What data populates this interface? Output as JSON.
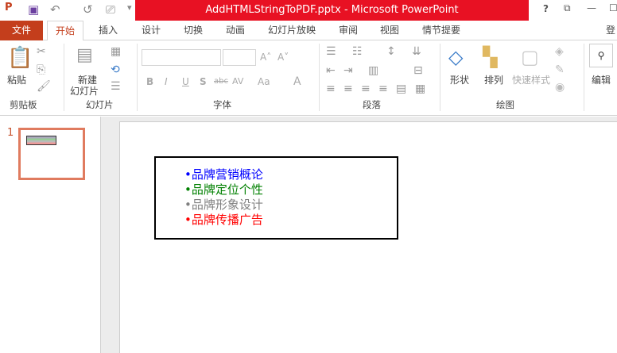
{
  "window": {
    "title": "AddHTMLStringToPDF.pptx -  Microsoft PowerPoint",
    "help": "?",
    "minimize": "—"
  },
  "tabs": [
    "文件",
    "开始",
    "插入",
    "设计",
    "切换",
    "动画",
    "幻灯片放映",
    "审阅",
    "视图",
    "情节提要",
    "登"
  ],
  "ribbon": {
    "clipboard": {
      "paste": "粘贴",
      "group": "剪贴板"
    },
    "slides": {
      "new_slide_1": "新建",
      "new_slide_2": "幻灯片",
      "group": "幻灯片"
    },
    "font": {
      "group": "字体",
      "bold": "B",
      "italic": "I",
      "underline": "U",
      "shadow": "S",
      "strike": "abc",
      "spacing": "AV",
      "case": "Aa",
      "color": "A",
      "grow": "A˄",
      "shrink": "A˅"
    },
    "paragraph": {
      "group": "段落"
    },
    "drawing": {
      "shapes": "形状",
      "arrange": "排列",
      "quick_styles": "快速样式",
      "group": "绘图"
    },
    "editing": {
      "label": "编辑"
    }
  },
  "thumbnail": {
    "number": "1"
  },
  "slide": {
    "items": [
      {
        "text": "•品牌营销概论",
        "color": "#0000ff"
      },
      {
        "text": "•品牌定位个性",
        "color": "#008000"
      },
      {
        "text": "•品牌形象设计",
        "color": "#808080"
      },
      {
        "text": "•品牌传播广告",
        "color": "#ff0000"
      }
    ]
  }
}
